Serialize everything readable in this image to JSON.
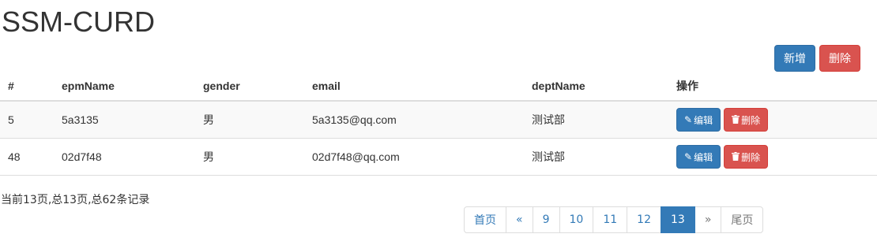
{
  "header": {
    "title": "SSM-CURD"
  },
  "actions": {
    "add_label": "新增",
    "delete_label": "删除"
  },
  "table": {
    "columns": [
      "#",
      "epmName",
      "gender",
      "email",
      "deptName",
      "操作"
    ],
    "rows": [
      {
        "id": "5",
        "name": "5a3135",
        "gender": "男",
        "email": "5a3135@qq.com",
        "dept": "测试部"
      },
      {
        "id": "48",
        "name": "02d7f48",
        "gender": "男",
        "email": "02d7f48@qq.com",
        "dept": "测试部"
      }
    ],
    "edit_label": "编辑",
    "delete_label": "删除",
    "edit_icon": "pencil-icon",
    "delete_icon": "trash-icon"
  },
  "page_info": "当前13页,总13页,总62条记录",
  "pagination": {
    "first": "首页",
    "prev": "«",
    "pages": [
      "9",
      "10",
      "11",
      "12",
      "13"
    ],
    "current": "13",
    "next": "»",
    "last": "尾页"
  },
  "colors": {
    "primary": "#337ab7",
    "danger": "#d9534f"
  }
}
